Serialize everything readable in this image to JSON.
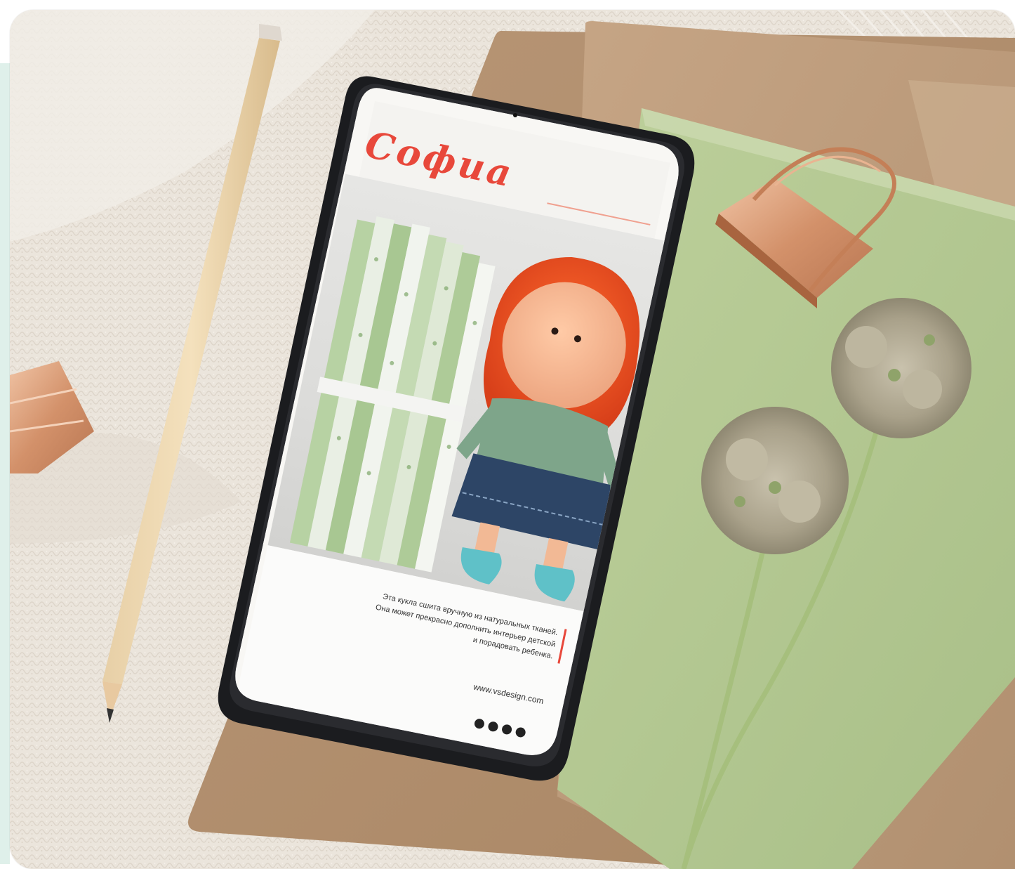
{
  "screen": {
    "brand_title": "Софиа",
    "description_lines": [
      "Эта кукла сшита вручную из натуральных тканей.",
      "Она может прекрасно дополнить интерьер детской",
      "и порадовать ребенка."
    ],
    "website": "www.vsdesign.com",
    "social_icons": [
      "instagram-icon",
      "facebook-icon",
      "twitter-icon",
      "youtube-icon"
    ]
  },
  "colors": {
    "brand_red": "#e8483b",
    "notebook_green": "#b5c993",
    "kraft_brown": "#b18f6e",
    "knit_cream": "#ece6dd",
    "copper": "#d79a72",
    "mint_background": "#dff0ea"
  }
}
